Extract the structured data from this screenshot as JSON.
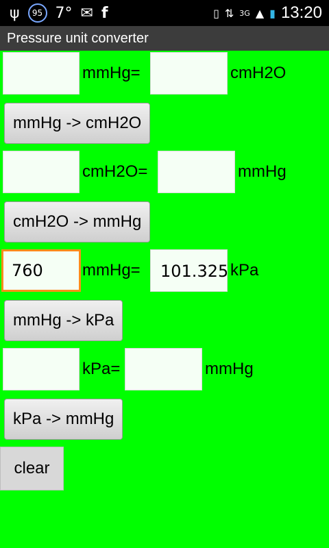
{
  "status_bar": {
    "badge": "95",
    "temperature": "7°",
    "network": "3G",
    "time": "13:20"
  },
  "title": "Pressure unit converter",
  "converters": [
    {
      "input1": "",
      "label1": "mmHg=",
      "input2": "",
      "label2": "cmH2O",
      "button": "mmHg -> cmH2O"
    },
    {
      "input1": "",
      "label1": "cmH2O=",
      "input2": "",
      "label2": "mmHg",
      "button": "cmH2O -> mmHg"
    },
    {
      "input1": "760",
      "label1": "mmHg=",
      "input2": "101.325",
      "label2": "kPa",
      "button": "mmHg -> kPa"
    },
    {
      "input1": "",
      "label1": "kPa=",
      "input2": "",
      "label2": "mmHg",
      "button": "kPa -> mmHg"
    }
  ],
  "clear_label": "clear"
}
